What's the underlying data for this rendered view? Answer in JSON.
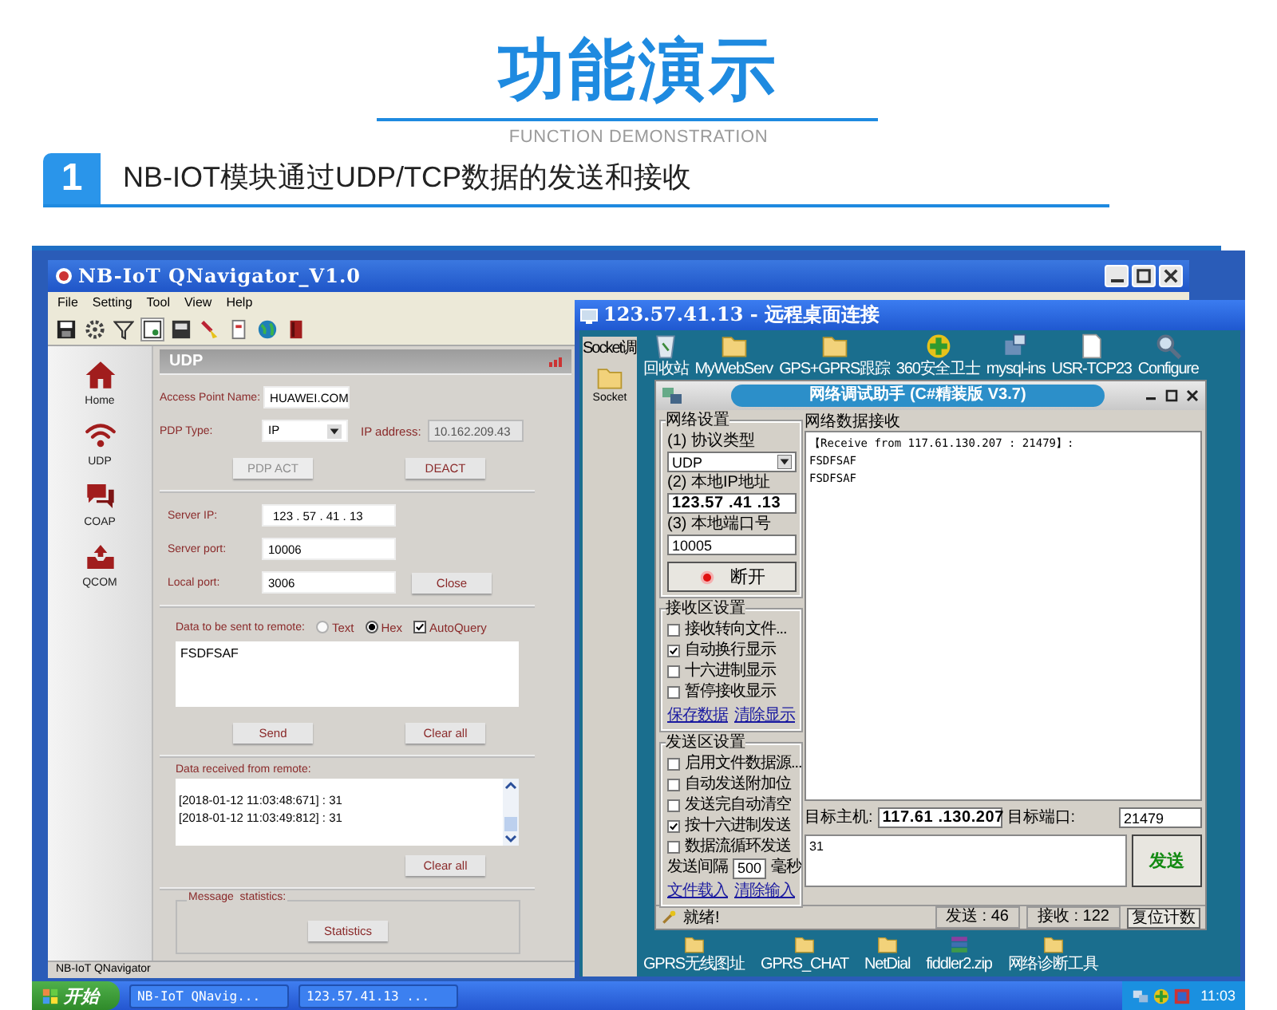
{
  "header": {
    "title": "功能演示",
    "subtitle": "FUNCTION DEMONSTRATION",
    "step_number": "1",
    "step_title": "NB-IOT模块通过UDP/TCP数据的发送和接收"
  },
  "qnavigator": {
    "title": "NB-IoT QNavigator_V1.0",
    "menu": [
      "File",
      "Setting",
      "Tool",
      "View",
      "Help"
    ],
    "sidebar": [
      {
        "label": "Home",
        "kind": "home"
      },
      {
        "label": "UDP",
        "kind": "wifi"
      },
      {
        "label": "COAP",
        "kind": "chat"
      },
      {
        "label": "QCOM",
        "kind": "tray"
      }
    ],
    "panel_title": "UDP",
    "apn": {
      "label": "Access Point Name:",
      "value": "HUAWEI.COM"
    },
    "pdp_type": {
      "label": "PDP Type:",
      "value": "IP"
    },
    "ip_address": {
      "label": "IP address:",
      "value": "10.162.209.43"
    },
    "pdp_act_button": {
      "label": "PDP ACT",
      "disabled": true
    },
    "deact_button": {
      "label": "DEACT",
      "disabled": false
    },
    "server_ip": {
      "label": "Server IP:",
      "value": "123  .  57  .  41  .  13"
    },
    "server_port": {
      "label": "Server port:",
      "value": "10006"
    },
    "local_port": {
      "label": "Local port:",
      "value": "3006"
    },
    "close_button": "Close",
    "send_label": "Data to be sent to remote:",
    "formats": [
      {
        "label": "Text",
        "selected": false
      },
      {
        "label": "Hex",
        "selected": true
      }
    ],
    "autoquery": {
      "label": "AutoQuery",
      "checked": true
    },
    "send_data": "FSDFSAF",
    "send_button": "Send",
    "clear_send_button": "Clear all",
    "received_label": "Data received from remote:",
    "received_lines": [
      "[2018-01-12 11:03:48:671] : 31",
      "[2018-01-12 11:03:49:812] : 31"
    ],
    "clear_received_button": "Clear all",
    "statistics_label": "Message  statistics:",
    "statistics_button": "Statistics",
    "status": "NB-IoT QNavigator"
  },
  "remote_desktop": {
    "title": "123.57.41.13 - 远程桌面连接",
    "side_window": {
      "title": "Socket调",
      "icon_label": "Socket"
    },
    "desktop_icons": [
      {
        "label": "回收站",
        "kind": "bin"
      },
      {
        "label": "MyWebServ",
        "kind": "folder"
      },
      {
        "label": "GPS+GPRS跟踪",
        "kind": "folder"
      },
      {
        "label": "360安全卫士",
        "kind": "shield"
      },
      {
        "label": "mysql-ins",
        "kind": "installer"
      },
      {
        "label": "USR-TCP23",
        "kind": "file"
      },
      {
        "label": "Configure",
        "kind": "magnifier"
      }
    ],
    "bottom_icons": [
      {
        "label": "GPRS无线图址",
        "kind": "folder"
      },
      {
        "label": "GPRS_CHAT",
        "kind": "folder"
      },
      {
        "label": "NetDial",
        "kind": "folder"
      },
      {
        "label": "fiddler2.zip",
        "kind": "archive"
      },
      {
        "label": "网络诊断工具",
        "kind": "folder"
      }
    ],
    "assistant": {
      "title": "网络调试助手 (C#精装版 V3.7)",
      "net_group": {
        "legend": "网络设置",
        "protocol_label": "(1) 协议类型",
        "protocol": "UDP",
        "ip_label": "(2) 本地IP地址",
        "ip": "123.57 .41 .13",
        "port_label": "(3) 本地端口号",
        "port": "10005",
        "connect_button": "断开"
      },
      "receive_group": {
        "legend": "接收区设置",
        "options": [
          {
            "label": "接收转向文件...",
            "checked": false
          },
          {
            "label": "自动换行显示",
            "checked": true
          },
          {
            "label": "十六进制显示",
            "checked": false
          },
          {
            "label": "暂停接收显示",
            "checked": false
          }
        ],
        "links": [
          "保存数据",
          "清除显示"
        ]
      },
      "send_group": {
        "legend": "发送区设置",
        "options": [
          {
            "label": "启用文件数据源...",
            "checked": false
          },
          {
            "label": "自动发送附加位",
            "checked": false
          },
          {
            "label": "发送完自动清空",
            "checked": false
          },
          {
            "label": "按十六进制发送",
            "checked": true
          },
          {
            "label": "数据流循环发送",
            "checked": false
          }
        ],
        "interval_label": "发送间隔",
        "interval": "500",
        "interval_unit": "毫秒",
        "links": [
          "文件载入",
          "清除输入"
        ]
      },
      "receive_title": "网络数据接收",
      "receive_lines": [
        "【Receive from 117.61.130.207 : 21479】:",
        "FSDFSAF",
        "FSDFSAF"
      ],
      "target_host_label": "目标主机:",
      "target_host": "117.61 .130.207",
      "target_port_label": "目标端口:",
      "target_port": "21479",
      "send_text": "31",
      "send_button": "发送",
      "status": "就绪!",
      "sent_count": "发送 : 46",
      "received_count": "接收 : 122",
      "reset_button": "复位计数"
    }
  },
  "taskbar": {
    "start": "开始",
    "tasks": [
      "NB-IoT QNavig...",
      "123.57.41.13 ..."
    ],
    "clock": "11:03"
  }
}
